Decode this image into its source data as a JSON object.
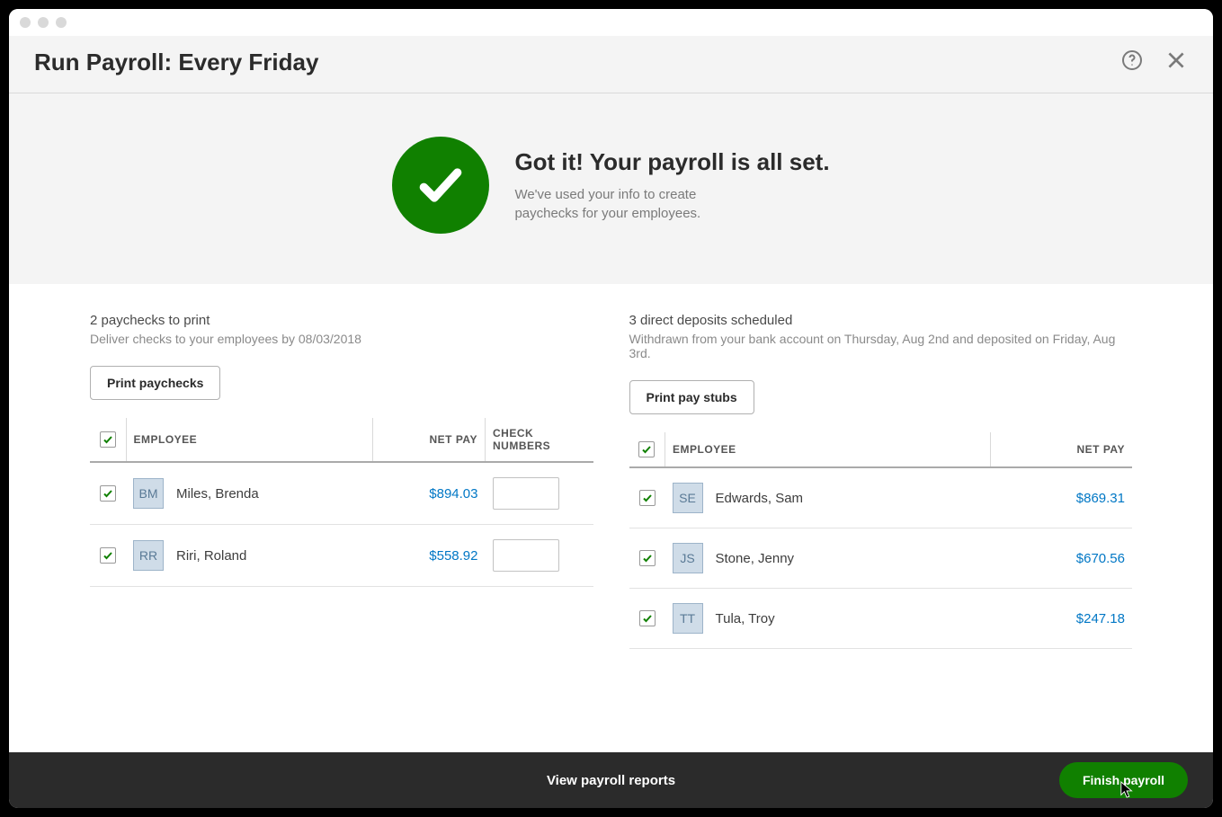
{
  "header": {
    "title": "Run Payroll: Every Friday"
  },
  "banner": {
    "title": "Got it! Your payroll is all set.",
    "subtitle": "We've used your info to create paychecks for your employees."
  },
  "paychecks": {
    "title": "2 paychecks to print",
    "subtitle": "Deliver checks to your employees by 08/03/2018",
    "button": "Print paychecks",
    "columns": {
      "employee": "EMPLOYEE",
      "netpay": "NET PAY",
      "checknum": "CHECK NUMBERS"
    },
    "rows": [
      {
        "initials": "BM",
        "name": "Miles, Brenda",
        "netpay": "$894.03",
        "checknum": ""
      },
      {
        "initials": "RR",
        "name": "Riri, Roland",
        "netpay": "$558.92",
        "checknum": ""
      }
    ]
  },
  "deposits": {
    "title": "3 direct deposits scheduled",
    "subtitle": "Withdrawn from your bank account on Thursday, Aug 2nd and deposited on Friday, Aug 3rd.",
    "button": "Print pay stubs",
    "columns": {
      "employee": "EMPLOYEE",
      "netpay": "NET PAY"
    },
    "rows": [
      {
        "initials": "SE",
        "name": "Edwards, Sam",
        "netpay": "$869.31"
      },
      {
        "initials": "JS",
        "name": "Stone, Jenny",
        "netpay": "$670.56"
      },
      {
        "initials": "TT",
        "name": "Tula, Troy",
        "netpay": "$247.18"
      }
    ]
  },
  "footer": {
    "reports_link": "View payroll reports",
    "finish_button": "Finish payroll"
  }
}
